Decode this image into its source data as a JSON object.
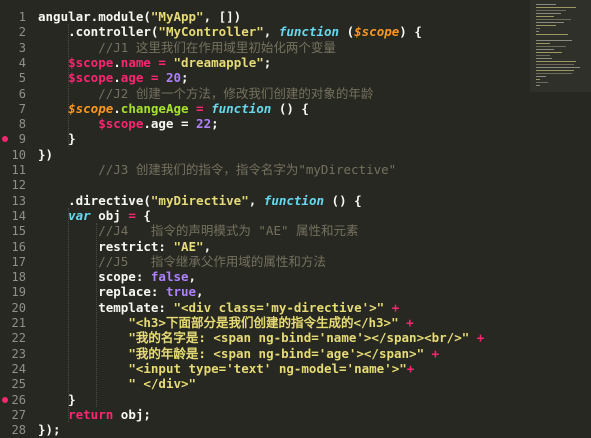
{
  "editor": {
    "theme_colors": {
      "background": "#272822",
      "text": "#f8f8f2",
      "keyword": "#f92672",
      "string": "#e6db74",
      "function_keyword": "#66d9ef",
      "parameter": "#fd971f",
      "property": "#a6e22e",
      "number": "#ae81ff",
      "comment": "#75715e",
      "line_number": "#8f908a"
    },
    "breakpoint_lines": [
      9,
      26
    ],
    "lines": [
      {
        "n": "1",
        "tokens": [
          {
            "t": "angular.module(",
            "c": ""
          },
          {
            "t": "\"MyApp\"",
            "c": "s"
          },
          {
            "t": ", [])",
            "c": ""
          }
        ]
      },
      {
        "n": "2",
        "tokens": [
          {
            "t": "    .controller(",
            "c": ""
          },
          {
            "t": "\"MyController\"",
            "c": "s"
          },
          {
            "t": ", ",
            "c": ""
          },
          {
            "t": "function",
            "c": "f"
          },
          {
            "t": " (",
            "c": ""
          },
          {
            "t": "$scope",
            "c": "p"
          },
          {
            "t": ") {",
            "c": ""
          }
        ]
      },
      {
        "n": "3",
        "tokens": [
          {
            "t": "        //J1 这里我们在作用域里初始化两个变量",
            "c": "c"
          }
        ]
      },
      {
        "n": "4",
        "tokens": [
          {
            "t": "    $scope",
            "c": "k"
          },
          {
            "t": ".",
            "c": ""
          },
          {
            "t": "name",
            "c": "k"
          },
          {
            "t": " = ",
            "c": "k"
          },
          {
            "t": "\"dreamapple\"",
            "c": "s"
          },
          {
            "t": ";",
            "c": ""
          }
        ]
      },
      {
        "n": "5",
        "tokens": [
          {
            "t": "    $scope",
            "c": "k"
          },
          {
            "t": ".",
            "c": ""
          },
          {
            "t": "age",
            "c": "k"
          },
          {
            "t": " = ",
            "c": "k"
          },
          {
            "t": "20",
            "c": "n"
          },
          {
            "t": ";",
            "c": ""
          }
        ]
      },
      {
        "n": "6",
        "tokens": [
          {
            "t": "        //J2 创建一个方法，修改我们创建的对象的年龄",
            "c": "c"
          }
        ]
      },
      {
        "n": "7",
        "tokens": [
          {
            "t": "    $scope",
            "c": "p"
          },
          {
            "t": ".",
            "c": ""
          },
          {
            "t": "changeAge",
            "c": "g"
          },
          {
            "t": " = ",
            "c": "k"
          },
          {
            "t": "function",
            "c": "f"
          },
          {
            "t": " () {",
            "c": ""
          }
        ]
      },
      {
        "n": "8",
        "tokens": [
          {
            "t": "        $scope",
            "c": "k"
          },
          {
            "t": ".age = ",
            "c": ""
          },
          {
            "t": "22",
            "c": "n"
          },
          {
            "t": ";",
            "c": ""
          }
        ]
      },
      {
        "n": "9",
        "tokens": [
          {
            "t": "    }",
            "c": ""
          }
        ]
      },
      {
        "n": "10",
        "tokens": [
          {
            "t": "})",
            "c": ""
          }
        ]
      },
      {
        "n": "11",
        "tokens": [
          {
            "t": "        //J3 创建我们的指令，指令名字为\"myDirective\"",
            "c": "c"
          }
        ]
      },
      {
        "n": "12",
        "tokens": [
          {
            "t": "",
            "c": ""
          }
        ]
      },
      {
        "n": "13",
        "tokens": [
          {
            "t": "    .directive(",
            "c": ""
          },
          {
            "t": "\"myDirective\"",
            "c": "s"
          },
          {
            "t": ", ",
            "c": ""
          },
          {
            "t": "function",
            "c": "f"
          },
          {
            "t": " () {",
            "c": ""
          }
        ]
      },
      {
        "n": "14",
        "tokens": [
          {
            "t": "    ",
            "c": ""
          },
          {
            "t": "var",
            "c": "f"
          },
          {
            "t": " obj ",
            "c": ""
          },
          {
            "t": "=",
            "c": "k"
          },
          {
            "t": " {",
            "c": ""
          }
        ]
      },
      {
        "n": "15",
        "tokens": [
          {
            "t": "        //J4   指令的声明模式为 \"AE\" 属性和元素",
            "c": "c"
          }
        ]
      },
      {
        "n": "16",
        "tokens": [
          {
            "t": "        restrict: ",
            "c": ""
          },
          {
            "t": "\"AE\"",
            "c": "s"
          },
          {
            "t": ",",
            "c": ""
          }
        ]
      },
      {
        "n": "17",
        "tokens": [
          {
            "t": "        //J5   指令继承父作用域的属性和方法",
            "c": "c"
          }
        ]
      },
      {
        "n": "18",
        "tokens": [
          {
            "t": "        scope: ",
            "c": ""
          },
          {
            "t": "false",
            "c": "n"
          },
          {
            "t": ",",
            "c": ""
          }
        ]
      },
      {
        "n": "19",
        "tokens": [
          {
            "t": "        replace: ",
            "c": ""
          },
          {
            "t": "true",
            "c": "n"
          },
          {
            "t": ",",
            "c": ""
          }
        ]
      },
      {
        "n": "20",
        "tokens": [
          {
            "t": "        template: ",
            "c": ""
          },
          {
            "t": "\"<div class='my-directive'>\"",
            "c": "s"
          },
          {
            "t": " +",
            "c": "k"
          }
        ]
      },
      {
        "n": "21",
        "tokens": [
          {
            "t": "            ",
            "c": ""
          },
          {
            "t": "\"<h3>下面部分是我们创建的指令生成的</h3>\"",
            "c": "s"
          },
          {
            "t": " +",
            "c": "k"
          }
        ]
      },
      {
        "n": "22",
        "tokens": [
          {
            "t": "            ",
            "c": ""
          },
          {
            "t": "\"我的名字是: <span ng-bind='name'></span><br/>\"",
            "c": "s"
          },
          {
            "t": " +",
            "c": "k"
          }
        ]
      },
      {
        "n": "23",
        "tokens": [
          {
            "t": "            ",
            "c": ""
          },
          {
            "t": "\"我的年龄是: <span ng-bind='age'></span>\"",
            "c": "s"
          },
          {
            "t": " +",
            "c": "k"
          }
        ]
      },
      {
        "n": "24",
        "tokens": [
          {
            "t": "            ",
            "c": ""
          },
          {
            "t": "\"<input type='text' ng-model='name'>\"",
            "c": "s"
          },
          {
            "t": "+",
            "c": "k"
          }
        ]
      },
      {
        "n": "25",
        "tokens": [
          {
            "t": "            ",
            "c": ""
          },
          {
            "t": "\" </div>\"",
            "c": "s"
          }
        ]
      },
      {
        "n": "26",
        "tokens": [
          {
            "t": "    }",
            "c": ""
          }
        ]
      },
      {
        "n": "27",
        "tokens": [
          {
            "t": "    ",
            "c": ""
          },
          {
            "t": "return",
            "c": "k"
          },
          {
            "t": " obj;",
            "c": ""
          }
        ]
      },
      {
        "n": "28",
        "tokens": [
          {
            "t": "});",
            "c": ""
          }
        ]
      }
    ]
  }
}
